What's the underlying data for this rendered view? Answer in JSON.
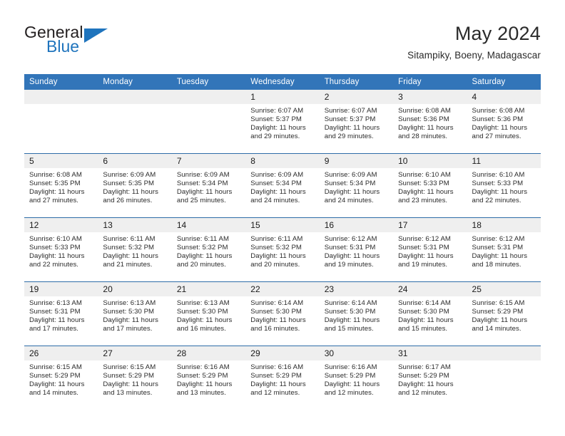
{
  "brand": {
    "name_primary": "General",
    "name_secondary": "Blue",
    "accent_color": "#1f74bd"
  },
  "header": {
    "title": "May 2024",
    "subtitle": "Sitampiky, Boeny, Madagascar"
  },
  "theme": {
    "header_row_bg": "#3275b9",
    "daynum_band_bg": "#efefef",
    "row_separator": "#2e6da8",
    "text_color": "#2b2b2b"
  },
  "weekday_headers": [
    "Sunday",
    "Monday",
    "Tuesday",
    "Wednesday",
    "Thursday",
    "Friday",
    "Saturday"
  ],
  "labels": {
    "sunrise_prefix": "Sunrise:",
    "sunset_prefix": "Sunset:",
    "daylight_prefix": "Daylight:"
  },
  "weeks": [
    [
      {
        "day": "",
        "blank": true
      },
      {
        "day": "",
        "blank": true
      },
      {
        "day": "",
        "blank": true
      },
      {
        "day": "1",
        "sunrise": "Sunrise: 6:07 AM",
        "sunset": "Sunset: 5:37 PM",
        "daylight_l1": "Daylight: 11 hours",
        "daylight_l2": "and 29 minutes."
      },
      {
        "day": "2",
        "sunrise": "Sunrise: 6:07 AM",
        "sunset": "Sunset: 5:37 PM",
        "daylight_l1": "Daylight: 11 hours",
        "daylight_l2": "and 29 minutes."
      },
      {
        "day": "3",
        "sunrise": "Sunrise: 6:08 AM",
        "sunset": "Sunset: 5:36 PM",
        "daylight_l1": "Daylight: 11 hours",
        "daylight_l2": "and 28 minutes."
      },
      {
        "day": "4",
        "sunrise": "Sunrise: 6:08 AM",
        "sunset": "Sunset: 5:36 PM",
        "daylight_l1": "Daylight: 11 hours",
        "daylight_l2": "and 27 minutes."
      }
    ],
    [
      {
        "day": "5",
        "sunrise": "Sunrise: 6:08 AM",
        "sunset": "Sunset: 5:35 PM",
        "daylight_l1": "Daylight: 11 hours",
        "daylight_l2": "and 27 minutes."
      },
      {
        "day": "6",
        "sunrise": "Sunrise: 6:09 AM",
        "sunset": "Sunset: 5:35 PM",
        "daylight_l1": "Daylight: 11 hours",
        "daylight_l2": "and 26 minutes."
      },
      {
        "day": "7",
        "sunrise": "Sunrise: 6:09 AM",
        "sunset": "Sunset: 5:34 PM",
        "daylight_l1": "Daylight: 11 hours",
        "daylight_l2": "and 25 minutes."
      },
      {
        "day": "8",
        "sunrise": "Sunrise: 6:09 AM",
        "sunset": "Sunset: 5:34 PM",
        "daylight_l1": "Daylight: 11 hours",
        "daylight_l2": "and 24 minutes."
      },
      {
        "day": "9",
        "sunrise": "Sunrise: 6:09 AM",
        "sunset": "Sunset: 5:34 PM",
        "daylight_l1": "Daylight: 11 hours",
        "daylight_l2": "and 24 minutes."
      },
      {
        "day": "10",
        "sunrise": "Sunrise: 6:10 AM",
        "sunset": "Sunset: 5:33 PM",
        "daylight_l1": "Daylight: 11 hours",
        "daylight_l2": "and 23 minutes."
      },
      {
        "day": "11",
        "sunrise": "Sunrise: 6:10 AM",
        "sunset": "Sunset: 5:33 PM",
        "daylight_l1": "Daylight: 11 hours",
        "daylight_l2": "and 22 minutes."
      }
    ],
    [
      {
        "day": "12",
        "sunrise": "Sunrise: 6:10 AM",
        "sunset": "Sunset: 5:33 PM",
        "daylight_l1": "Daylight: 11 hours",
        "daylight_l2": "and 22 minutes."
      },
      {
        "day": "13",
        "sunrise": "Sunrise: 6:11 AM",
        "sunset": "Sunset: 5:32 PM",
        "daylight_l1": "Daylight: 11 hours",
        "daylight_l2": "and 21 minutes."
      },
      {
        "day": "14",
        "sunrise": "Sunrise: 6:11 AM",
        "sunset": "Sunset: 5:32 PM",
        "daylight_l1": "Daylight: 11 hours",
        "daylight_l2": "and 20 minutes."
      },
      {
        "day": "15",
        "sunrise": "Sunrise: 6:11 AM",
        "sunset": "Sunset: 5:32 PM",
        "daylight_l1": "Daylight: 11 hours",
        "daylight_l2": "and 20 minutes."
      },
      {
        "day": "16",
        "sunrise": "Sunrise: 6:12 AM",
        "sunset": "Sunset: 5:31 PM",
        "daylight_l1": "Daylight: 11 hours",
        "daylight_l2": "and 19 minutes."
      },
      {
        "day": "17",
        "sunrise": "Sunrise: 6:12 AM",
        "sunset": "Sunset: 5:31 PM",
        "daylight_l1": "Daylight: 11 hours",
        "daylight_l2": "and 19 minutes."
      },
      {
        "day": "18",
        "sunrise": "Sunrise: 6:12 AM",
        "sunset": "Sunset: 5:31 PM",
        "daylight_l1": "Daylight: 11 hours",
        "daylight_l2": "and 18 minutes."
      }
    ],
    [
      {
        "day": "19",
        "sunrise": "Sunrise: 6:13 AM",
        "sunset": "Sunset: 5:31 PM",
        "daylight_l1": "Daylight: 11 hours",
        "daylight_l2": "and 17 minutes."
      },
      {
        "day": "20",
        "sunrise": "Sunrise: 6:13 AM",
        "sunset": "Sunset: 5:30 PM",
        "daylight_l1": "Daylight: 11 hours",
        "daylight_l2": "and 17 minutes."
      },
      {
        "day": "21",
        "sunrise": "Sunrise: 6:13 AM",
        "sunset": "Sunset: 5:30 PM",
        "daylight_l1": "Daylight: 11 hours",
        "daylight_l2": "and 16 minutes."
      },
      {
        "day": "22",
        "sunrise": "Sunrise: 6:14 AM",
        "sunset": "Sunset: 5:30 PM",
        "daylight_l1": "Daylight: 11 hours",
        "daylight_l2": "and 16 minutes."
      },
      {
        "day": "23",
        "sunrise": "Sunrise: 6:14 AM",
        "sunset": "Sunset: 5:30 PM",
        "daylight_l1": "Daylight: 11 hours",
        "daylight_l2": "and 15 minutes."
      },
      {
        "day": "24",
        "sunrise": "Sunrise: 6:14 AM",
        "sunset": "Sunset: 5:30 PM",
        "daylight_l1": "Daylight: 11 hours",
        "daylight_l2": "and 15 minutes."
      },
      {
        "day": "25",
        "sunrise": "Sunrise: 6:15 AM",
        "sunset": "Sunset: 5:29 PM",
        "daylight_l1": "Daylight: 11 hours",
        "daylight_l2": "and 14 minutes."
      }
    ],
    [
      {
        "day": "26",
        "sunrise": "Sunrise: 6:15 AM",
        "sunset": "Sunset: 5:29 PM",
        "daylight_l1": "Daylight: 11 hours",
        "daylight_l2": "and 14 minutes."
      },
      {
        "day": "27",
        "sunrise": "Sunrise: 6:15 AM",
        "sunset": "Sunset: 5:29 PM",
        "daylight_l1": "Daylight: 11 hours",
        "daylight_l2": "and 13 minutes."
      },
      {
        "day": "28",
        "sunrise": "Sunrise: 6:16 AM",
        "sunset": "Sunset: 5:29 PM",
        "daylight_l1": "Daylight: 11 hours",
        "daylight_l2": "and 13 minutes."
      },
      {
        "day": "29",
        "sunrise": "Sunrise: 6:16 AM",
        "sunset": "Sunset: 5:29 PM",
        "daylight_l1": "Daylight: 11 hours",
        "daylight_l2": "and 12 minutes."
      },
      {
        "day": "30",
        "sunrise": "Sunrise: 6:16 AM",
        "sunset": "Sunset: 5:29 PM",
        "daylight_l1": "Daylight: 11 hours",
        "daylight_l2": "and 12 minutes."
      },
      {
        "day": "31",
        "sunrise": "Sunrise: 6:17 AM",
        "sunset": "Sunset: 5:29 PM",
        "daylight_l1": "Daylight: 11 hours",
        "daylight_l2": "and 12 minutes."
      },
      {
        "day": "",
        "blank": true
      }
    ]
  ]
}
